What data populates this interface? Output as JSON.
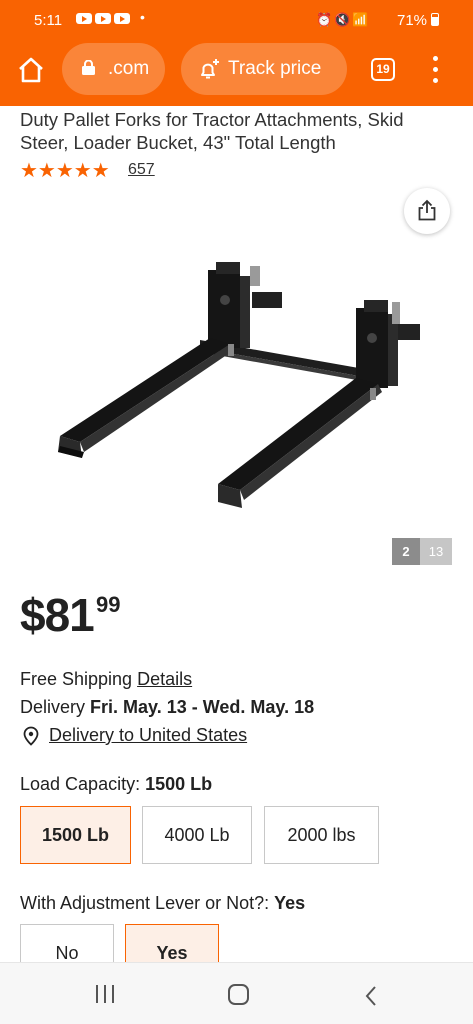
{
  "status_bar": {
    "time": "5:11",
    "battery": "71%"
  },
  "browser": {
    "url": ".com",
    "track_price_label": "Track price",
    "tab_count": "19"
  },
  "product": {
    "title": "Duty Pallet Forks for Tractor Attachments, Skid Steer, Loader Bucket, 43\" Total Length",
    "stars": "★★★★★",
    "rating_fraction": 1.0,
    "review_count": "657",
    "image_counter": {
      "current": "2",
      "total": "13"
    },
    "price": {
      "dollars": "$81",
      "cents": "99"
    }
  },
  "shipping": {
    "free_shipping": "Free Shipping",
    "details_link": "Details",
    "delivery_label": "Delivery",
    "delivery_dates": "Fri. May. 13 - Wed. May. 18",
    "delivery_location_link": "Delivery to United States"
  },
  "options": {
    "load_capacity": {
      "label": "Load Capacity:",
      "selected_value": "1500 Lb",
      "choices": [
        "1500 Lb",
        "4000 Lb",
        "2000 lbs"
      ]
    },
    "adjustment_lever": {
      "label": "With Adjustment Lever or Not?:",
      "selected_value": "Yes",
      "choices": [
        "No",
        "Yes"
      ]
    }
  },
  "colors": {
    "brand_orange": "#f96302",
    "selected_bg": "#fdefe6"
  }
}
